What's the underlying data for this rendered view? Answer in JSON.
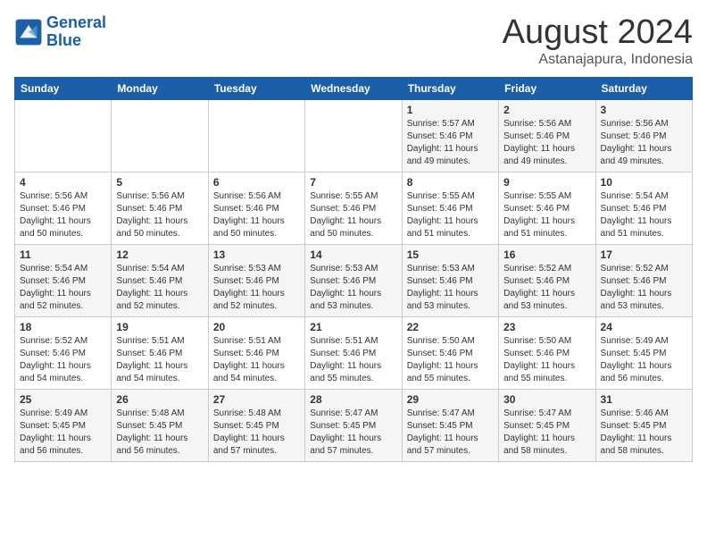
{
  "header": {
    "logo_line1": "General",
    "logo_line2": "Blue",
    "month_year": "August 2024",
    "location": "Astanajapura, Indonesia"
  },
  "weekdays": [
    "Sunday",
    "Monday",
    "Tuesday",
    "Wednesday",
    "Thursday",
    "Friday",
    "Saturday"
  ],
  "weeks": [
    [
      {
        "day": "",
        "info": ""
      },
      {
        "day": "",
        "info": ""
      },
      {
        "day": "",
        "info": ""
      },
      {
        "day": "",
        "info": ""
      },
      {
        "day": "1",
        "info": "Sunrise: 5:57 AM\nSunset: 5:46 PM\nDaylight: 11 hours\nand 49 minutes."
      },
      {
        "day": "2",
        "info": "Sunrise: 5:56 AM\nSunset: 5:46 PM\nDaylight: 11 hours\nand 49 minutes."
      },
      {
        "day": "3",
        "info": "Sunrise: 5:56 AM\nSunset: 5:46 PM\nDaylight: 11 hours\nand 49 minutes."
      }
    ],
    [
      {
        "day": "4",
        "info": "Sunrise: 5:56 AM\nSunset: 5:46 PM\nDaylight: 11 hours\nand 50 minutes."
      },
      {
        "day": "5",
        "info": "Sunrise: 5:56 AM\nSunset: 5:46 PM\nDaylight: 11 hours\nand 50 minutes."
      },
      {
        "day": "6",
        "info": "Sunrise: 5:56 AM\nSunset: 5:46 PM\nDaylight: 11 hours\nand 50 minutes."
      },
      {
        "day": "7",
        "info": "Sunrise: 5:55 AM\nSunset: 5:46 PM\nDaylight: 11 hours\nand 50 minutes."
      },
      {
        "day": "8",
        "info": "Sunrise: 5:55 AM\nSunset: 5:46 PM\nDaylight: 11 hours\nand 51 minutes."
      },
      {
        "day": "9",
        "info": "Sunrise: 5:55 AM\nSunset: 5:46 PM\nDaylight: 11 hours\nand 51 minutes."
      },
      {
        "day": "10",
        "info": "Sunrise: 5:54 AM\nSunset: 5:46 PM\nDaylight: 11 hours\nand 51 minutes."
      }
    ],
    [
      {
        "day": "11",
        "info": "Sunrise: 5:54 AM\nSunset: 5:46 PM\nDaylight: 11 hours\nand 52 minutes."
      },
      {
        "day": "12",
        "info": "Sunrise: 5:54 AM\nSunset: 5:46 PM\nDaylight: 11 hours\nand 52 minutes."
      },
      {
        "day": "13",
        "info": "Sunrise: 5:53 AM\nSunset: 5:46 PM\nDaylight: 11 hours\nand 52 minutes."
      },
      {
        "day": "14",
        "info": "Sunrise: 5:53 AM\nSunset: 5:46 PM\nDaylight: 11 hours\nand 53 minutes."
      },
      {
        "day": "15",
        "info": "Sunrise: 5:53 AM\nSunset: 5:46 PM\nDaylight: 11 hours\nand 53 minutes."
      },
      {
        "day": "16",
        "info": "Sunrise: 5:52 AM\nSunset: 5:46 PM\nDaylight: 11 hours\nand 53 minutes."
      },
      {
        "day": "17",
        "info": "Sunrise: 5:52 AM\nSunset: 5:46 PM\nDaylight: 11 hours\nand 53 minutes."
      }
    ],
    [
      {
        "day": "18",
        "info": "Sunrise: 5:52 AM\nSunset: 5:46 PM\nDaylight: 11 hours\nand 54 minutes."
      },
      {
        "day": "19",
        "info": "Sunrise: 5:51 AM\nSunset: 5:46 PM\nDaylight: 11 hours\nand 54 minutes."
      },
      {
        "day": "20",
        "info": "Sunrise: 5:51 AM\nSunset: 5:46 PM\nDaylight: 11 hours\nand 54 minutes."
      },
      {
        "day": "21",
        "info": "Sunrise: 5:51 AM\nSunset: 5:46 PM\nDaylight: 11 hours\nand 55 minutes."
      },
      {
        "day": "22",
        "info": "Sunrise: 5:50 AM\nSunset: 5:46 PM\nDaylight: 11 hours\nand 55 minutes."
      },
      {
        "day": "23",
        "info": "Sunrise: 5:50 AM\nSunset: 5:46 PM\nDaylight: 11 hours\nand 55 minutes."
      },
      {
        "day": "24",
        "info": "Sunrise: 5:49 AM\nSunset: 5:45 PM\nDaylight: 11 hours\nand 56 minutes."
      }
    ],
    [
      {
        "day": "25",
        "info": "Sunrise: 5:49 AM\nSunset: 5:45 PM\nDaylight: 11 hours\nand 56 minutes."
      },
      {
        "day": "26",
        "info": "Sunrise: 5:48 AM\nSunset: 5:45 PM\nDaylight: 11 hours\nand 56 minutes."
      },
      {
        "day": "27",
        "info": "Sunrise: 5:48 AM\nSunset: 5:45 PM\nDaylight: 11 hours\nand 57 minutes."
      },
      {
        "day": "28",
        "info": "Sunrise: 5:47 AM\nSunset: 5:45 PM\nDaylight: 11 hours\nand 57 minutes."
      },
      {
        "day": "29",
        "info": "Sunrise: 5:47 AM\nSunset: 5:45 PM\nDaylight: 11 hours\nand 57 minutes."
      },
      {
        "day": "30",
        "info": "Sunrise: 5:47 AM\nSunset: 5:45 PM\nDaylight: 11 hours\nand 58 minutes."
      },
      {
        "day": "31",
        "info": "Sunrise: 5:46 AM\nSunset: 5:45 PM\nDaylight: 11 hours\nand 58 minutes."
      }
    ]
  ]
}
